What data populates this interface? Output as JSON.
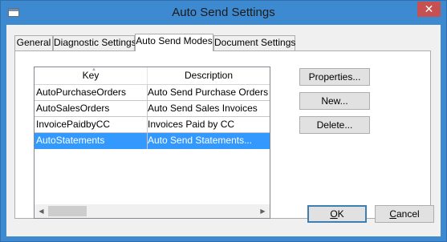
{
  "window": {
    "title": "Auto Send Settings",
    "close_glyph": "✕"
  },
  "tabs": [
    {
      "label": "General"
    },
    {
      "label": "Diagnostic Settings"
    },
    {
      "label": "Auto Send Modes"
    },
    {
      "label": "Document Settings"
    }
  ],
  "active_tab": "Auto Send Modes",
  "list": {
    "columns": [
      "Key",
      "Description"
    ],
    "rows": [
      {
        "key": "AutoPurchaseOrders",
        "description": "Auto Send Purchase Orders"
      },
      {
        "key": "AutoSalesOrders",
        "description": "Auto Send Sales Invoices"
      },
      {
        "key": "InvoicePaidbyCC",
        "description": "Invoices Paid by CC"
      },
      {
        "key": "AutoStatements",
        "description": "Auto Send Statements..."
      }
    ],
    "selected_row": "AutoStatements",
    "scroll_left_glyph": "◀",
    "scroll_right_glyph": "▶"
  },
  "actions": {
    "properties": "Properties...",
    "new": "New...",
    "delete": "Delete..."
  },
  "footer": {
    "ok": "OK",
    "cancel": "Cancel"
  },
  "colors": {
    "title_bar": "#3e8ad1",
    "close_button": "#c75050",
    "selection": "#3399ff"
  },
  "icons": {
    "window": "app-window-icon",
    "close": "close-icon",
    "scroll_left": "arrow-left-icon",
    "scroll_right": "arrow-right-icon"
  }
}
